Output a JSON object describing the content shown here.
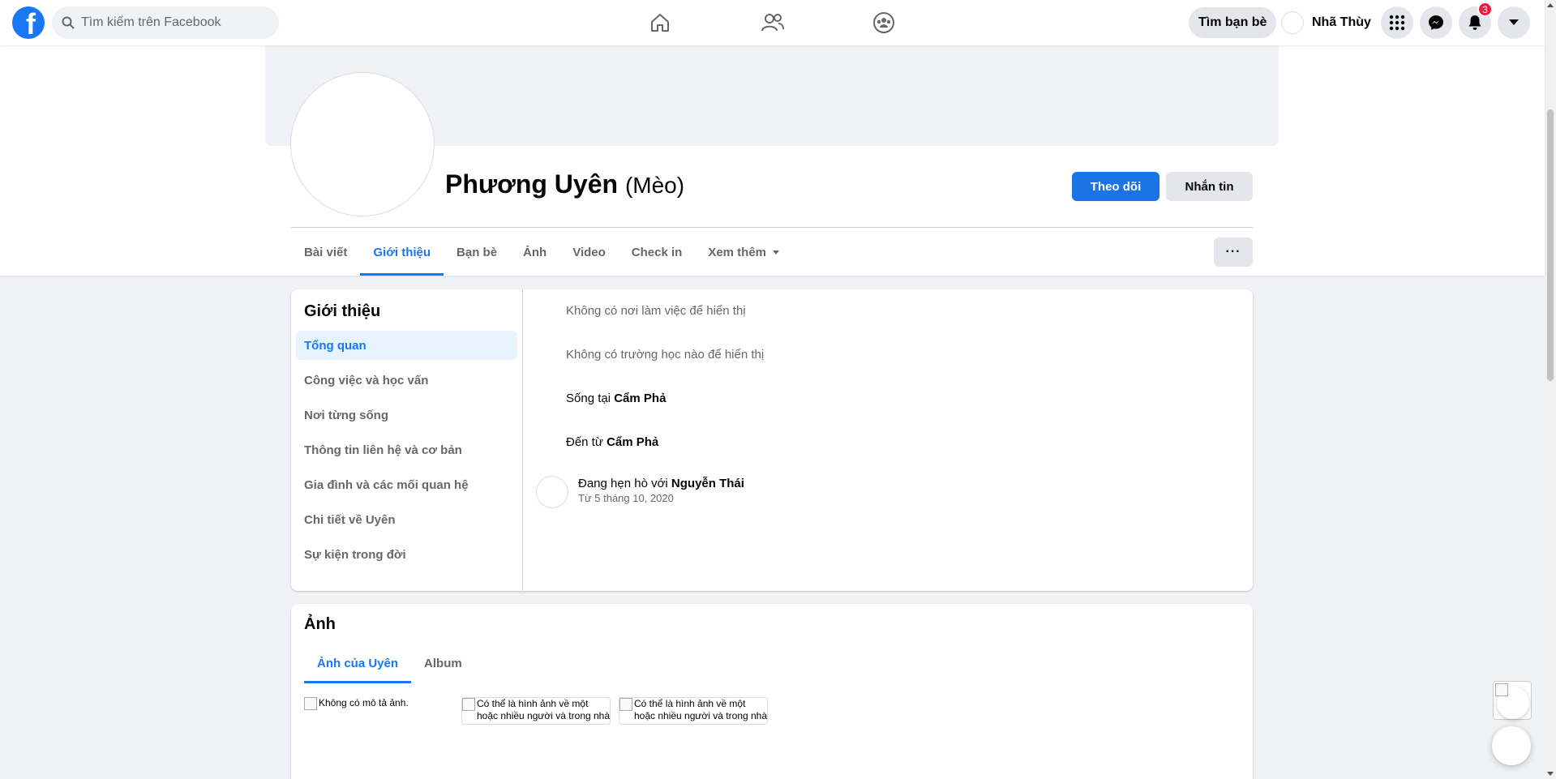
{
  "topbar": {
    "logo_letter": "f",
    "search_placeholder": "Tìm kiếm trên Facebook",
    "find_friends": "Tìm bạn bè",
    "user_name": "Nhã Thùy",
    "notifications_count": "3"
  },
  "profile": {
    "name": "Phương Uyên",
    "nickname": "(Mèo)",
    "follow_label": "Theo dõi",
    "message_label": "Nhắn tin",
    "more_label": "···",
    "tabs": [
      "Bài viết",
      "Giới thiệu",
      "Bạn bè",
      "Ảnh",
      "Video",
      "Check in",
      "Xem thêm"
    ]
  },
  "about": {
    "title": "Giới thiệu",
    "menu": [
      "Tổng quan",
      "Công việc và học vấn",
      "Nơi từng sống",
      "Thông tin liên hệ và cơ bản",
      "Gia đình và các mối quan hệ",
      "Chi tiết về Uyên",
      "Sự kiện trong đời"
    ],
    "no_work": "Không có nơi làm việc để hiển thị",
    "no_school": "Không có trường học nào để hiển thị",
    "lives_prefix": "Sống tại ",
    "lives_place": "Cẩm Phả",
    "from_prefix": "Đến từ ",
    "from_place": "Cẩm Phả",
    "relationship_prefix": "Đang hẹn hò với ",
    "relationship_partner": "Nguyễn Thái",
    "relationship_since": "Từ 5 tháng 10, 2020"
  },
  "photos": {
    "title": "Ảnh",
    "tabs": [
      "Ảnh của Uyên",
      "Album"
    ],
    "alt_texts": [
      "Không có mô tả ảnh.",
      "Có thể là hình ảnh về một hoặc nhiều người và trong nhà",
      "Có thể là hình ảnh về một hoặc nhiều người và trong nhà"
    ]
  },
  "colors": {
    "accent": "#1877f2",
    "badge": "#e41e3f"
  }
}
